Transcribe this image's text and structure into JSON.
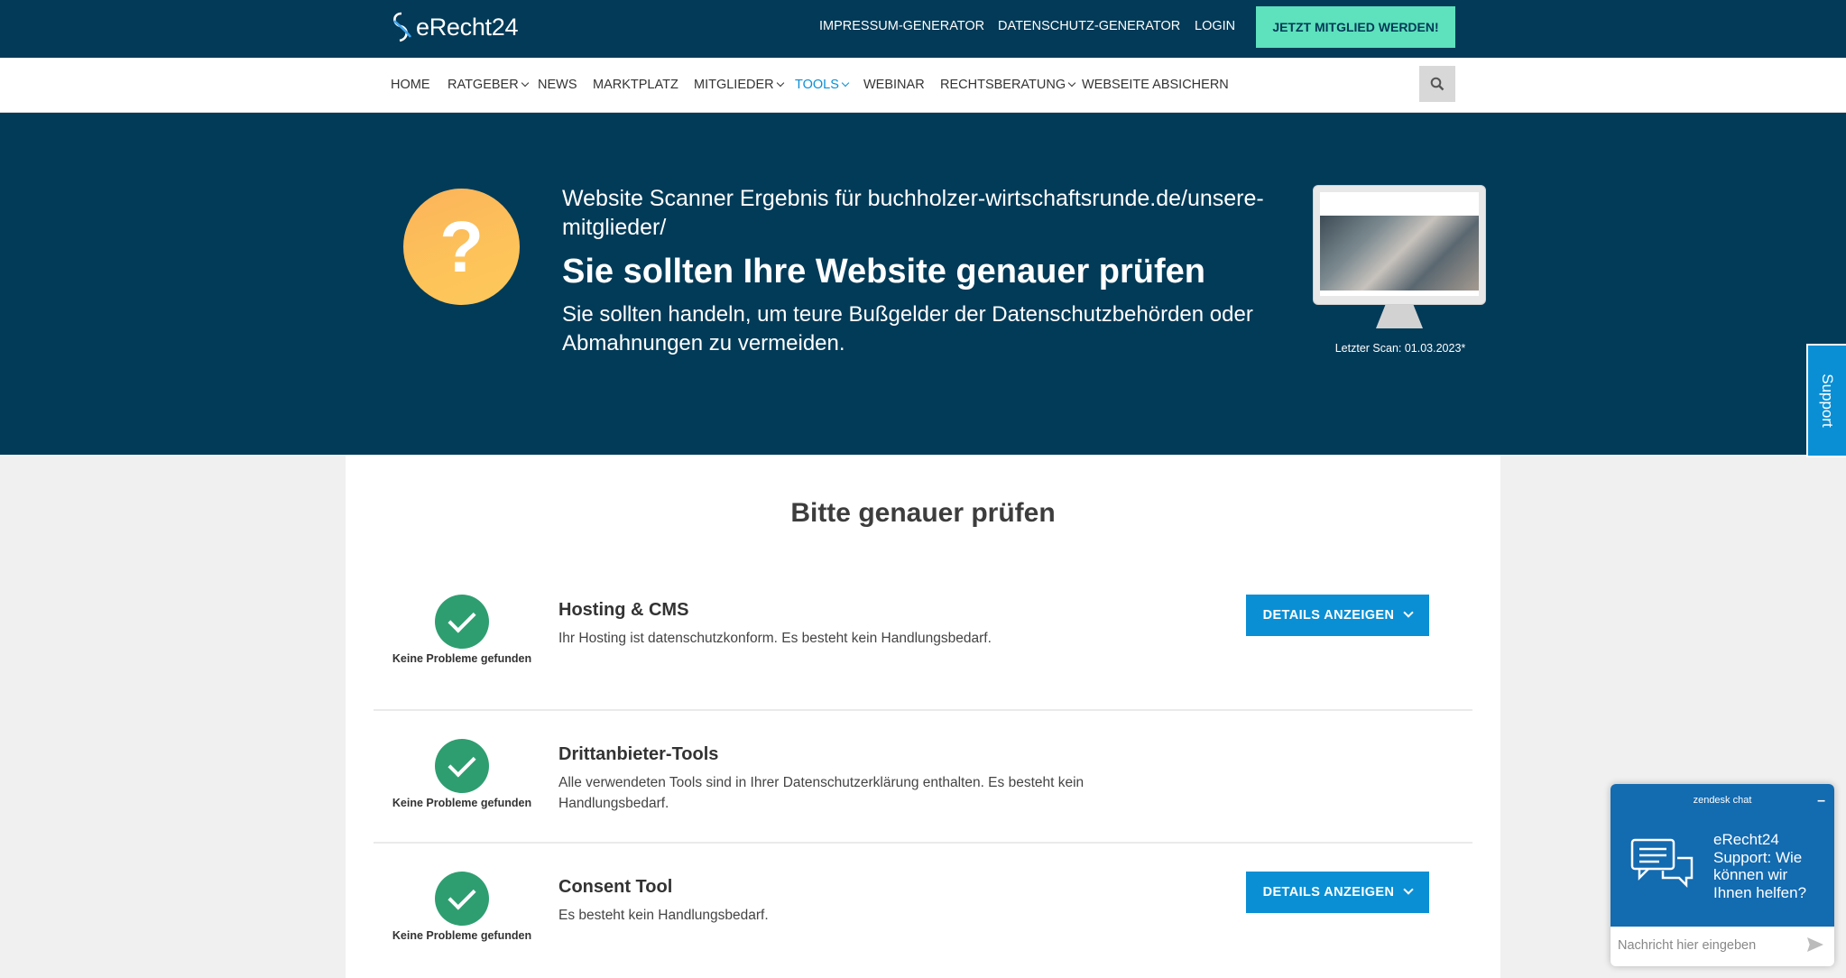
{
  "header": {
    "logo_text": "eRecht24",
    "links": [
      "IMPRESSUM-GENERATOR",
      "DATENSCHUTZ-GENERATOR",
      "LOGIN"
    ],
    "cta": "JETZT MITGLIED WERDEN!"
  },
  "nav": {
    "items": [
      {
        "label": "HOME",
        "dropdown": false
      },
      {
        "label": "RATGEBER",
        "dropdown": true
      },
      {
        "label": "NEWS",
        "dropdown": false
      },
      {
        "label": "MARKTPLATZ",
        "dropdown": false
      },
      {
        "label": "MITGLIEDER",
        "dropdown": true
      },
      {
        "label": "TOOLS",
        "dropdown": true,
        "active": true
      },
      {
        "label": "WEBINAR",
        "dropdown": false
      },
      {
        "label": "RECHTSBERATUNG",
        "dropdown": true
      },
      {
        "label": "WEBSEITE ABSICHERN",
        "dropdown": false
      }
    ],
    "search_icon": "search-icon"
  },
  "hero": {
    "status_symbol": "?",
    "scan_line": "Website Scanner Ergebnis für buchholzer-wirtschaftsrunde.de/unsere-mitglieder/",
    "title": "Sie sollten Ihre Website genauer prüfen",
    "subtitle": "Sie sollten handeln, um teure Bußgelder der Datenschutzbehörden oder Abmahnungen zu vermeiden.",
    "last_scan": "Letzter Scan: 01.03.2023*"
  },
  "support_tab": "Support",
  "results": {
    "title": "Bitte genauer prüfen",
    "rows": [
      {
        "status": "Keine Probleme gefunden",
        "title": "Hosting & CMS",
        "desc": "Ihr Hosting ist datenschutzkonform. Es besteht kein Handlungsbedarf.",
        "button": "DETAILS ANZEIGEN"
      },
      {
        "status": "Keine Probleme gefunden",
        "title": "Drittanbieter-Tools",
        "desc": "Alle verwendeten Tools sind in Ihrer Datenschutzerklärung enthalten. Es besteht kein Handlungsbedarf.",
        "button": ""
      },
      {
        "status": "Keine Probleme gefunden",
        "title": "Consent Tool",
        "desc": "Es besteht kein Handlungsbedarf.",
        "button": "DETAILS ANZEIGEN"
      }
    ]
  },
  "chat": {
    "brand": "zendesk chat",
    "minimize": "–",
    "message": "eRecht24 Support: Wie können wir Ihnen helfen?",
    "placeholder": "Nachricht hier eingeben"
  },
  "colors": {
    "header_bg": "#023a57",
    "cta_bg": "#5ee1bd",
    "accent": "#0a8fd4",
    "check_green": "#2e9e70",
    "warning_orange": "#fdb85a"
  }
}
